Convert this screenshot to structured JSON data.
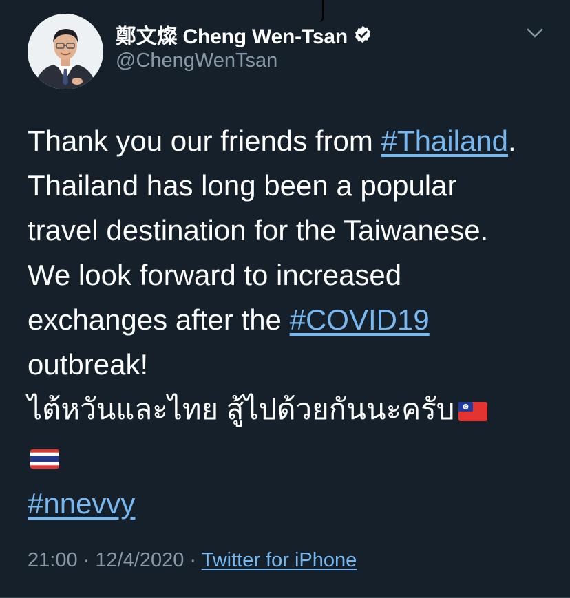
{
  "author": {
    "display_name": "鄭文燦 Cheng Wen-Tsan",
    "handle": "@ChengWenTsan",
    "verified": true
  },
  "tweet": {
    "line1_text": "Thank you our friends from ",
    "line1_hashtag": "#Thailand",
    "line1_end": ".",
    "line2": "Thailand has long been a popular",
    "line3": "travel destination for the Taiwanese.",
    "line4": "We look forward to increased",
    "line5_text": "exchanges after the ",
    "line5_hashtag": "#COVID19",
    "line6": "outbreak!",
    "line7": "ไต้หวันและไทย สู้ไปด้วยกันนะครับ",
    "flag1_icon": "taiwan-flag-icon",
    "flag2_icon": "thailand-flag-icon",
    "hashtag_last": "#nnevvy"
  },
  "meta": {
    "time": "21:00",
    "sep1": " · ",
    "date": "12/4/2020",
    "sep2": " · ",
    "source": "Twitter for iPhone"
  },
  "icons": {
    "verified": "verified-badge-icon",
    "more": "chevron-down-icon"
  },
  "colors": {
    "background": "#15202b",
    "link": "#78b8f0",
    "secondary_text": "#8899a6"
  }
}
